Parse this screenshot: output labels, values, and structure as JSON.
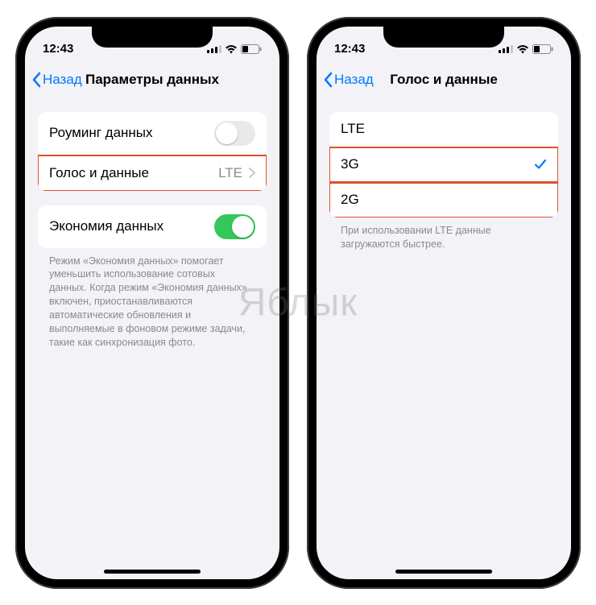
{
  "watermark": "Яблык",
  "status": {
    "time": "12:43"
  },
  "left_phone": {
    "back_label": "Назад",
    "title": "Параметры данных",
    "rows": {
      "roaming_label": "Роуминг данных",
      "voice_data_label": "Голос и данные",
      "voice_data_value": "LTE",
      "low_data_label": "Экономия данных"
    },
    "footer": "Режим «Экономия данных» помогает уменьшить использование сотовых данных. Когда режим «Экономия данных» включен, приостанавливаются автоматические обновления и выполняемые в фоновом режиме задачи, такие как синхронизация фото."
  },
  "right_phone": {
    "back_label": "Назад",
    "title": "Голос и данные",
    "options": {
      "lte": "LTE",
      "g3": "3G",
      "g2": "2G"
    },
    "selected": "3G",
    "footer": "При использовании LTE данные загружаются быстрее."
  }
}
